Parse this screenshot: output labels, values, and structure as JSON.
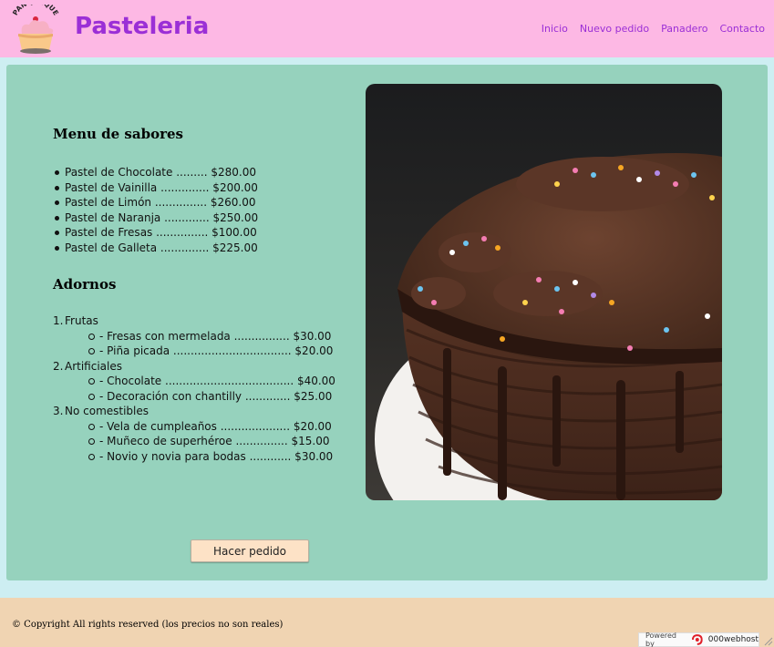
{
  "header": {
    "logo_text": "PANQUEQUE",
    "brand": "Pasteleria",
    "nav": [
      "Inicio",
      "Nuevo pedido",
      "Panadero",
      "Contacto"
    ]
  },
  "menu": {
    "title": "Menu de sabores",
    "items": [
      "Pastel de Chocolate ......... $280.00",
      "Pastel de Vainilla .............. $200.00",
      "Pastel de Limón ............... $260.00",
      "Pastel de Naranja ............. $250.00",
      "Pastel de Fresas ............... $100.00",
      "Pastel de Galleta .............. $225.00"
    ]
  },
  "adornos": {
    "title": "Adornos",
    "categories": [
      {
        "num": "1.",
        "name": "Frutas",
        "items": [
          "- Fresas con mermelada ................ $30.00",
          "- Piña picada .................................. $20.00"
        ]
      },
      {
        "num": "2.",
        "name": "Artificiales",
        "items": [
          "- Chocolate ..................................... $40.00",
          "- Decoración con chantilly ............. $25.00"
        ]
      },
      {
        "num": "3.",
        "name": "No comestibles",
        "items": [
          "- Vela de cumpleaños .................... $20.00",
          "- Muñeco de superhéroe ............... $15.00",
          "- Novio y novia para bodas ............ $30.00"
        ]
      }
    ]
  },
  "order_button": "Hacer pedido",
  "footer": {
    "copyright": "© Copyright All rights reserved (los precios no son reales)",
    "powered_by": "Powered by",
    "host": "000webhost"
  }
}
